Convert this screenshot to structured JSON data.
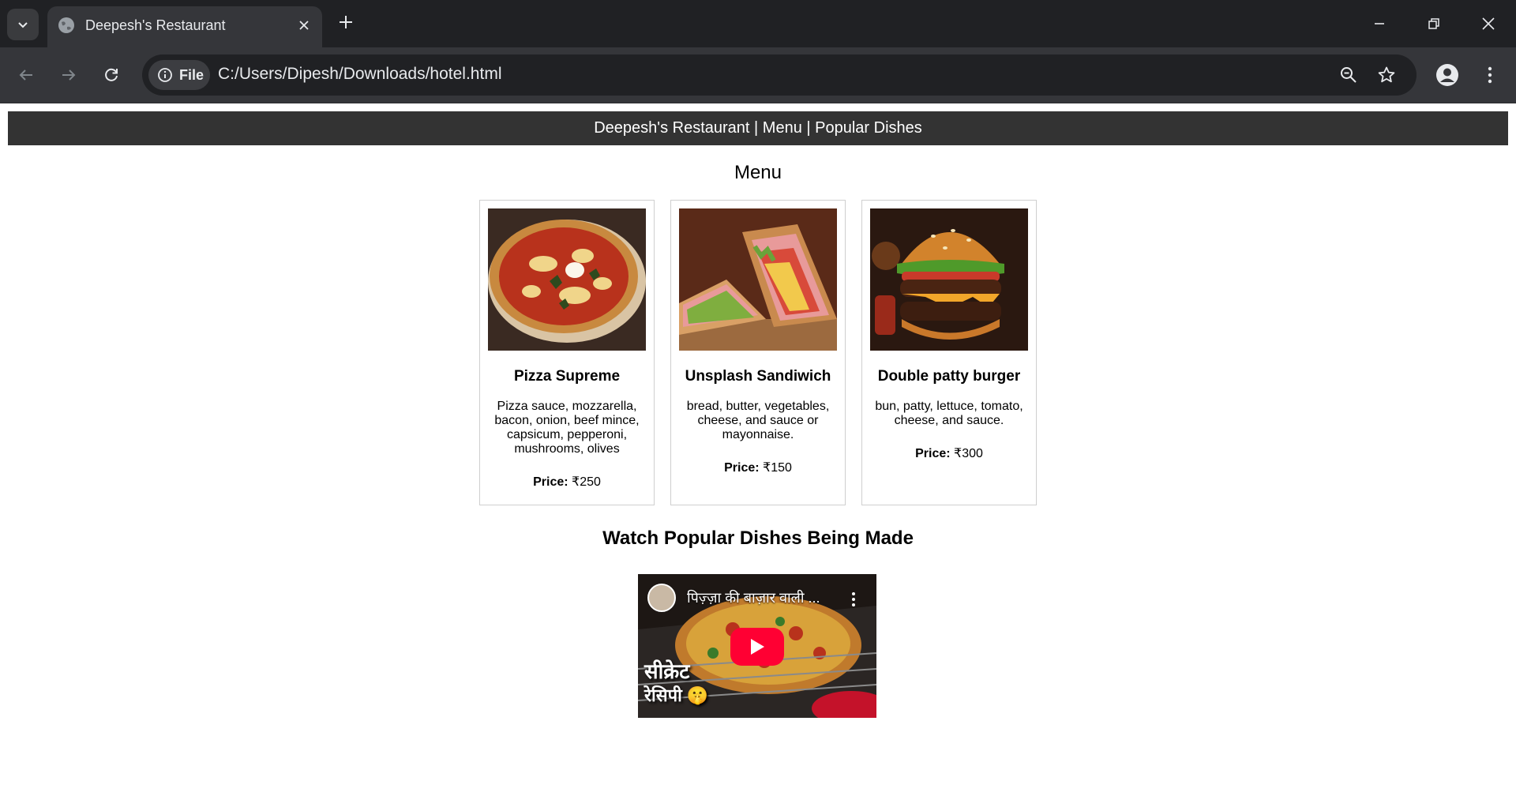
{
  "browser": {
    "tab": {
      "title": "Deepesh's Restaurant",
      "favicon": "globe-icon"
    },
    "address_bar": {
      "site_info_label": "File",
      "url": "C:/Users/Dipesh/Downloads/hotel.html"
    },
    "icons": [
      "tab-search-icon",
      "close-icon",
      "plus-icon",
      "minimize-icon",
      "restore-icon",
      "window-close-icon",
      "back-arrow-icon",
      "forward-arrow-icon",
      "reload-icon",
      "info-icon",
      "zoom-icon",
      "star-icon",
      "profile-icon",
      "kebab-menu-icon"
    ]
  },
  "header": {
    "text": "Deepesh's Restaurant | Menu | Popular Dishes",
    "background": "#333333"
  },
  "menu": {
    "heading": "Menu",
    "items": [
      {
        "name": "Pizza Supreme",
        "description": "Pizza sauce, mozzarella, bacon, onion, beef mince, capsicum, pepperoni, mushrooms, olives",
        "price_label": "Price:",
        "price": "₹250",
        "image": "pizza-photo"
      },
      {
        "name": "Unsplash Sandiwich",
        "description": "bread, butter, vegetables, cheese, and sauce or mayonnaise.",
        "price_label": "Price:",
        "price": "₹150",
        "image": "sandwich-photo"
      },
      {
        "name": "Double patty burger",
        "description": "bun, patty, lettuce, tomato, cheese, and sauce.",
        "price_label": "Price:",
        "price": "₹300",
        "image": "burger-photo"
      }
    ]
  },
  "videos": {
    "heading": "Watch Popular Dishes Being Made",
    "video": {
      "title": "पिज़्ज़ा की बाज़ार वाली ...",
      "overlay_line1": "सीक्रेट",
      "overlay_line2": "रेसिपी 🤫",
      "play_color": "#ff0033"
    }
  }
}
